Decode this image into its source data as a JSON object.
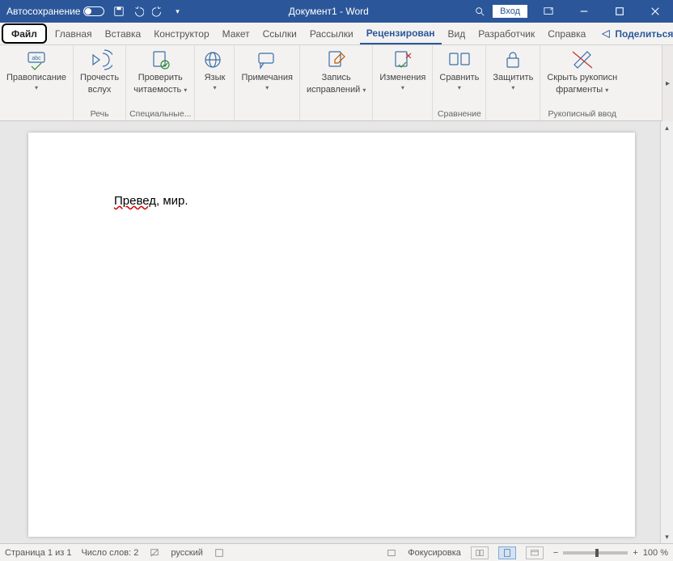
{
  "titlebar": {
    "autosave_label": "Автосохранение",
    "title": "Документ1  -  Word",
    "login": "Вход"
  },
  "tabs": {
    "file": "Файл",
    "home": "Главная",
    "insert": "Вставка",
    "design": "Конструктор",
    "layout": "Макет",
    "references": "Ссылки",
    "mailings": "Рассылки",
    "review": "Рецензирован",
    "view": "Вид",
    "developer": "Разработчик",
    "help": "Справка",
    "share": "Поделиться"
  },
  "ribbon": {
    "spelling": "Правописание",
    "readaloud_l1": "Прочесть",
    "readaloud_l2": "вслух",
    "accessibility_l1": "Проверить",
    "accessibility_l2": "читаемость",
    "language": "Язык",
    "comments": "Примечания",
    "track_l1": "Запись",
    "track_l2": "исправлений",
    "changes": "Изменения",
    "compare": "Сравнить",
    "protect": "Защитить",
    "ink_l1": "Скрыть рукописн",
    "ink_l2": "фрагменты",
    "grp_speech": "Речь",
    "grp_access": "Специальные...",
    "grp_compare": "Сравнение",
    "grp_ink": "Рукописный ввод"
  },
  "document": {
    "word_err": "Превед",
    "rest": ", мир."
  },
  "status": {
    "page": "Страница 1 из 1",
    "words": "Число слов: 2",
    "lang": "русский",
    "focus": "Фокусировка",
    "zoom": "100 %"
  }
}
